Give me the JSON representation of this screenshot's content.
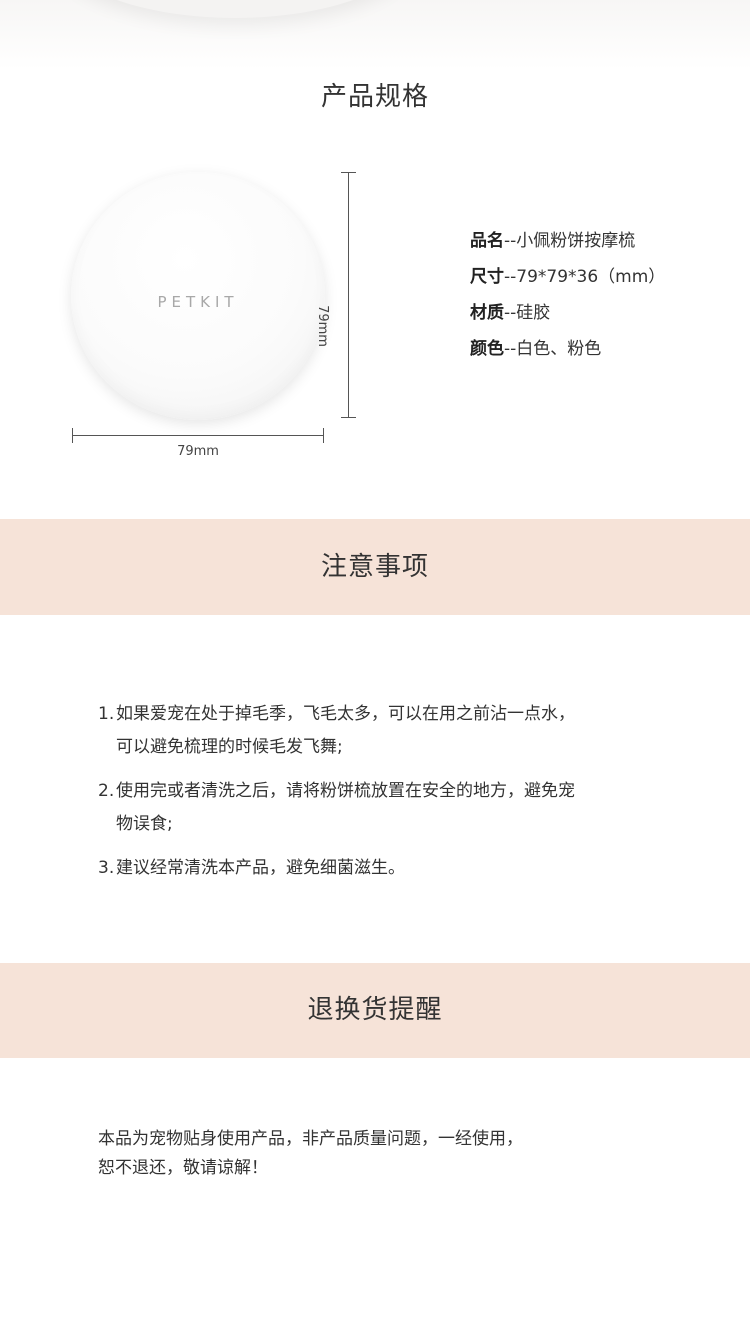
{
  "spec": {
    "title": "产品规格",
    "brand": "PETKIT",
    "dim_width": "79mm",
    "dim_height": "79mm",
    "rows": [
      {
        "key": "品名",
        "value": "--小佩粉饼按摩梳"
      },
      {
        "key": "尺寸",
        "value": "--79*79*36（mm）"
      },
      {
        "key": "材质",
        "value": "--硅胶"
      },
      {
        "key": "颜色",
        "value": "--白色、粉色"
      }
    ]
  },
  "notice": {
    "title": "注意事项",
    "items": [
      {
        "num": "1.",
        "line1": "如果爱宠在处于掉毛季，飞毛太多，可以在用之前沾一点水，",
        "line2": "可以避免梳理的时候毛发飞舞;"
      },
      {
        "num": "2.",
        "line1": "使用完或者清洗之后，请将粉饼梳放置在安全的地方，避免宠",
        "line2": "物误食;"
      },
      {
        "num": "3.",
        "line1": "建议经常清洗本产品，避免细菌滋生。",
        "line2": ""
      }
    ]
  },
  "return_policy": {
    "title": "退换货提醒",
    "line1": "本品为宠物贴身使用产品，非产品质量问题，一经使用，",
    "line2": "恕不退还，敬请谅解！"
  },
  "colors": {
    "band": "#f6e3d8",
    "text": "#333333"
  }
}
